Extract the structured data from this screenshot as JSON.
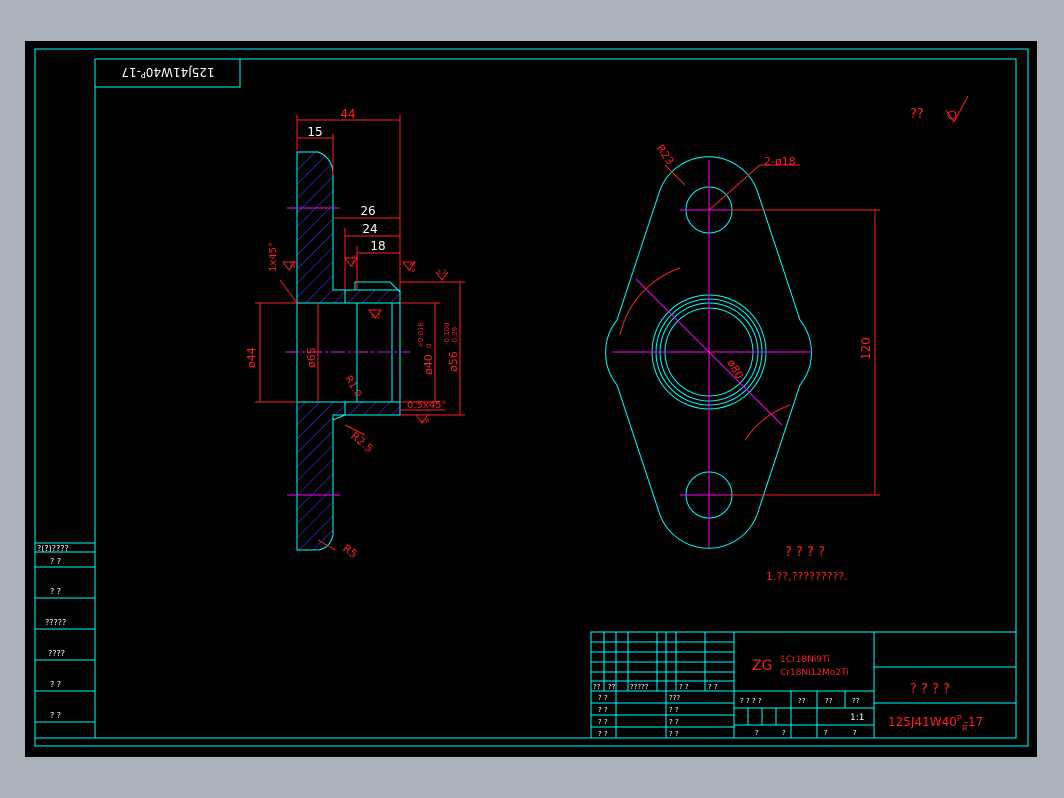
{
  "colors": {
    "cyan": "#00ffff",
    "red": "#ff2020",
    "magenta": "#ff00ff",
    "blue": "#3b3bff",
    "white": "#ffffff",
    "background": "#000000",
    "frame": "#a9b1bb"
  },
  "stamp": {
    "code": "125J41W40",
    "sup": "P",
    "sub": "R",
    "suffix": "-17"
  },
  "roughness": {
    "symbol": "??"
  },
  "section_view": {
    "dims": {
      "d44top": "44",
      "d15": "15",
      "d26": "26",
      "d24": "24",
      "d18": "18",
      "chamfer": "1x45°",
      "phi44": "ø44",
      "phi65": "ø65",
      "phi40": "ø40",
      "phi40tol_up": "+0.016",
      "phi40tol_lo": "0",
      "phi56": "ø56",
      "phi56tol_up": "-0.100",
      "phi56tol_lo": "-0.29",
      "r10": "R1.0",
      "r25": "R2.5",
      "r5": "R5",
      "chamfer2": "0.5x45°"
    },
    "rough": {
      "r1": "25",
      "r2": "12.5",
      "r3": "6.3",
      "r4": "3.2",
      "r5": "3.2",
      "r6": "6.3",
      "r7": "1.6"
    }
  },
  "plan_view": {
    "dims": {
      "r23": "R23",
      "holes": "2-ø18",
      "phi80": "ø80",
      "d120": "120"
    }
  },
  "notes": {
    "title": "? ? ? ?",
    "line1": "1.??,?????????."
  },
  "left_table": {
    "header": "?(?)????",
    "rows": [
      "?   ?",
      "?   ?",
      "?????",
      "????",
      "?   ?",
      "?   ?"
    ]
  },
  "title_block": {
    "material1": "ZG",
    "material2": "1Cr18Ni9Ti",
    "material3": "Cr18Ni12Mo2Ti",
    "name": "? ? ? ?",
    "code": "125J41W40",
    "code_sup": "P",
    "code_sub": "R",
    "code_suffix": "-17",
    "scale": "1:1",
    "hdr_row": [
      "??",
      "??",
      "?????",
      "?  ?",
      "?  ?"
    ],
    "row_labels": [
      "? ?",
      "? ?",
      "? ?",
      "? ?"
    ],
    "row_labels2": [
      "???",
      "? ?",
      "? ?",
      "? ?"
    ],
    "mid_row": [
      "? ? ? ?",
      "??",
      "??",
      "??"
    ],
    "bottom_row": [
      "?",
      "?",
      "?",
      "?"
    ]
  }
}
